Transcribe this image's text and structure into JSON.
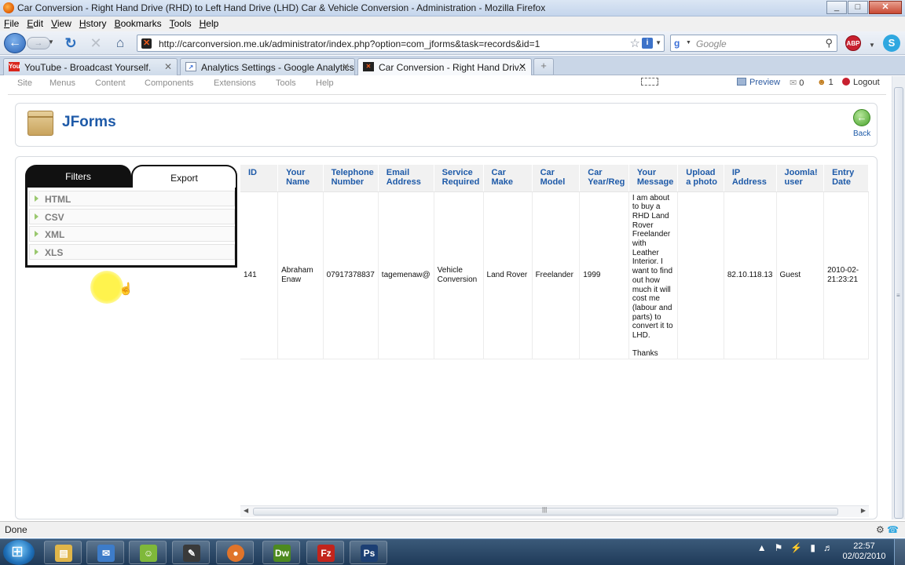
{
  "window": {
    "title": "Car Conversion - Right Hand Drive (RHD) to Left Hand Drive (LHD) Car & Vehicle Conversion - Administration - Mozilla Firefox",
    "controls": [
      "_",
      "□",
      "✕"
    ]
  },
  "menubar": {
    "items": [
      {
        "key": "F",
        "rest": "ile"
      },
      {
        "key": "E",
        "rest": "dit"
      },
      {
        "key": "V",
        "rest": "iew"
      },
      {
        "key": "H",
        "pre": "Hi",
        "rest": "story"
      },
      {
        "key": "B",
        "rest": "ookmarks"
      },
      {
        "key": "T",
        "rest": "ools"
      },
      {
        "key": "H",
        "rest": "elp"
      }
    ]
  },
  "navbar": {
    "url": "http://carconversion.me.uk/administrator/index.php?option=com_jforms&task=records&id=1",
    "search_placeholder": "Google",
    "abp": "ABP"
  },
  "tabs": [
    {
      "label": "YouTube - Broadcast Yourself.",
      "icon": "youtube-icon",
      "active": false
    },
    {
      "label": "Analytics Settings - Google Analytics",
      "icon": "analytics-icon",
      "active": false
    },
    {
      "label": "Car Conversion - Right Hand Driv...",
      "icon": "joomla-icon",
      "active": true
    }
  ],
  "admin_menu": {
    "items": [
      "Site",
      "Menus",
      "Content",
      "Components",
      "Extensions",
      "Tools",
      "Help"
    ],
    "preview": "Preview",
    "messages_count": "0",
    "users_count": "1",
    "logout": "Logout"
  },
  "header": {
    "title": "JForms",
    "back_label": "Back"
  },
  "side_panel": {
    "tabs": [
      "Filters",
      "Export"
    ],
    "active_tab": "Export",
    "export_options": [
      "HTML",
      "CSV",
      "XML",
      "XLS"
    ]
  },
  "table": {
    "columns": [
      "ID",
      "Your Name",
      "Telephone Number",
      "Email Address",
      "Service Required",
      "Car Make",
      "Car Model",
      "Car Year/Reg",
      "Your Message",
      "Upload a photo",
      "IP Address",
      "Joomla! user",
      "Entry Date"
    ],
    "rows": [
      [
        "141",
        "Abraham Enaw",
        "07917378837",
        "tagemenaw@",
        "Vehicle Conversion",
        "Land Rover",
        "Freelander",
        "1999",
        "I am about to buy a RHD Land Rover Freelander with Leather Interior. I want to find out how much it will cost me (labour and parts) to convert it to LHD.\n\nThanks",
        "",
        "82.10.118.13",
        "Guest",
        "2010-02-\n21:23:21"
      ]
    ]
  },
  "status": {
    "text": "Done"
  },
  "taskbar": {
    "apps": [
      {
        "name": "explorer",
        "icon": "folder-icon",
        "glyph": "▤",
        "color": "#e0b64a"
      },
      {
        "name": "thunderbird",
        "icon": "mail-icon",
        "glyph": "✉",
        "color": "#3d7cc9"
      },
      {
        "name": "messenger",
        "icon": "people-icon",
        "glyph": "☺",
        "color": "#7fb83a"
      },
      {
        "name": "editor",
        "icon": "pencil-icon",
        "glyph": "✎",
        "color": "#3a3a3a"
      },
      {
        "name": "firefox",
        "icon": "firefox-icon",
        "glyph": "●",
        "color": "#e0742a"
      },
      {
        "name": "dreamweaver",
        "icon": "dreamweaver-icon",
        "glyph": "Dw",
        "color": "#4d8a1f"
      },
      {
        "name": "filezilla",
        "icon": "filezilla-icon",
        "glyph": "Fz",
        "color": "#c2241c"
      },
      {
        "name": "photoshop",
        "icon": "photoshop-icon",
        "glyph": "Ps",
        "color": "#1c3f74"
      }
    ],
    "time": "22:57",
    "date": "02/02/2010"
  }
}
